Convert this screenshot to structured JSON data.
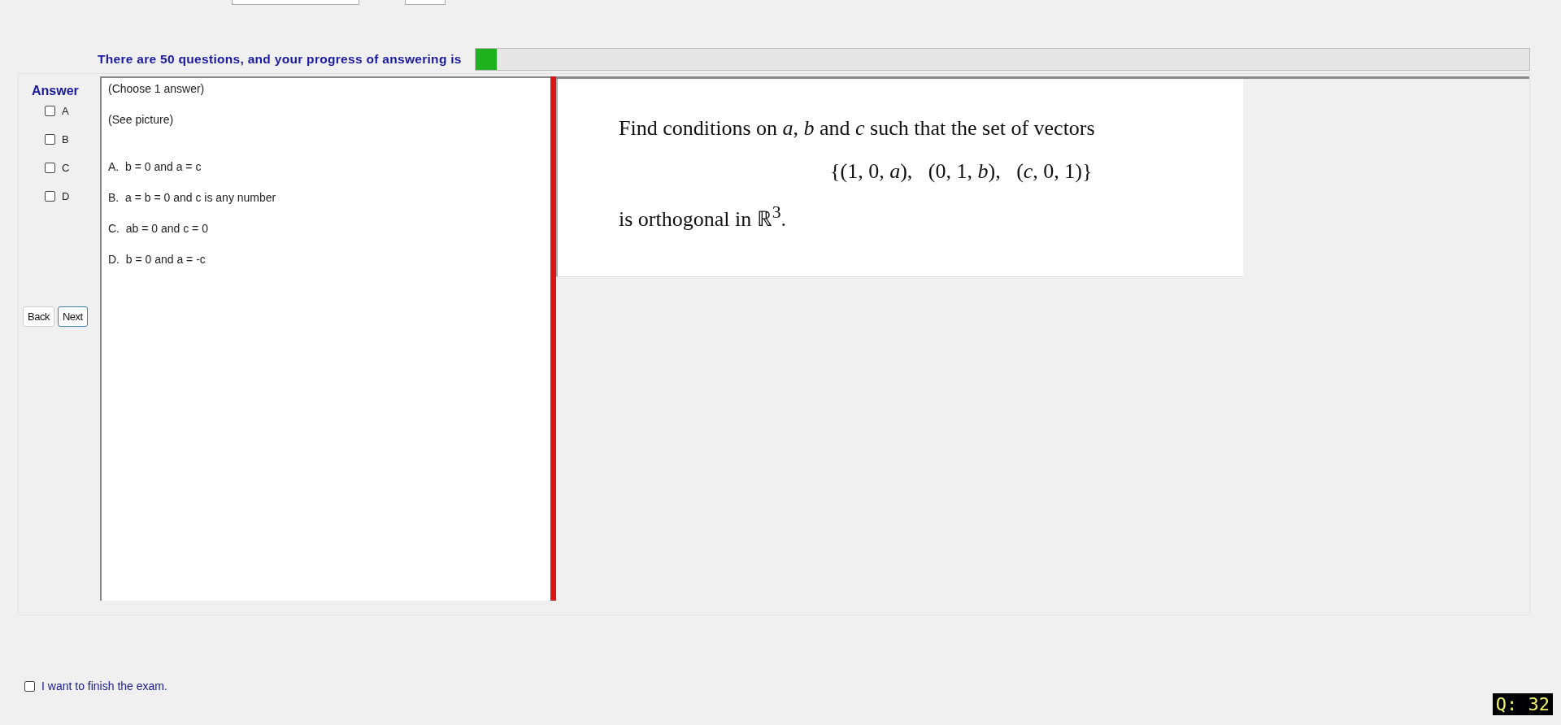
{
  "progress": {
    "label": "There are 50 questions, and your progress of answering is",
    "level": 0.02
  },
  "answer": {
    "title": "Answer",
    "options": [
      {
        "label": "A",
        "checked": false
      },
      {
        "label": "B",
        "checked": false
      },
      {
        "label": "C",
        "checked": false
      },
      {
        "label": "D",
        "checked": false
      }
    ]
  },
  "buttons": [
    {
      "label": "Back",
      "focused": false
    },
    {
      "label": "Next",
      "focused": true
    }
  ],
  "question_text": {
    "notes": [
      "(Choose 1 answer)",
      "(See picture)"
    ],
    "choices": [
      "A.  b = 0 and a = c",
      "B.  a = b = 0 and c is any number",
      "C.  ab = 0 and c = 0",
      "D.  b = 0 and a = -c"
    ]
  },
  "question_picture": [
    "Find conditions on *a*, *b* and *c* such that the set of vectors",
    "{(1, 0, *a*),   (0, 1, *b*),   (*c*, 0, 1)}",
    "is orthogonal in ℝ$^{3}$."
  ],
  "finish": {
    "label": "I want to finish the exam.",
    "checked": false
  },
  "question_badge": "Q: 32"
}
